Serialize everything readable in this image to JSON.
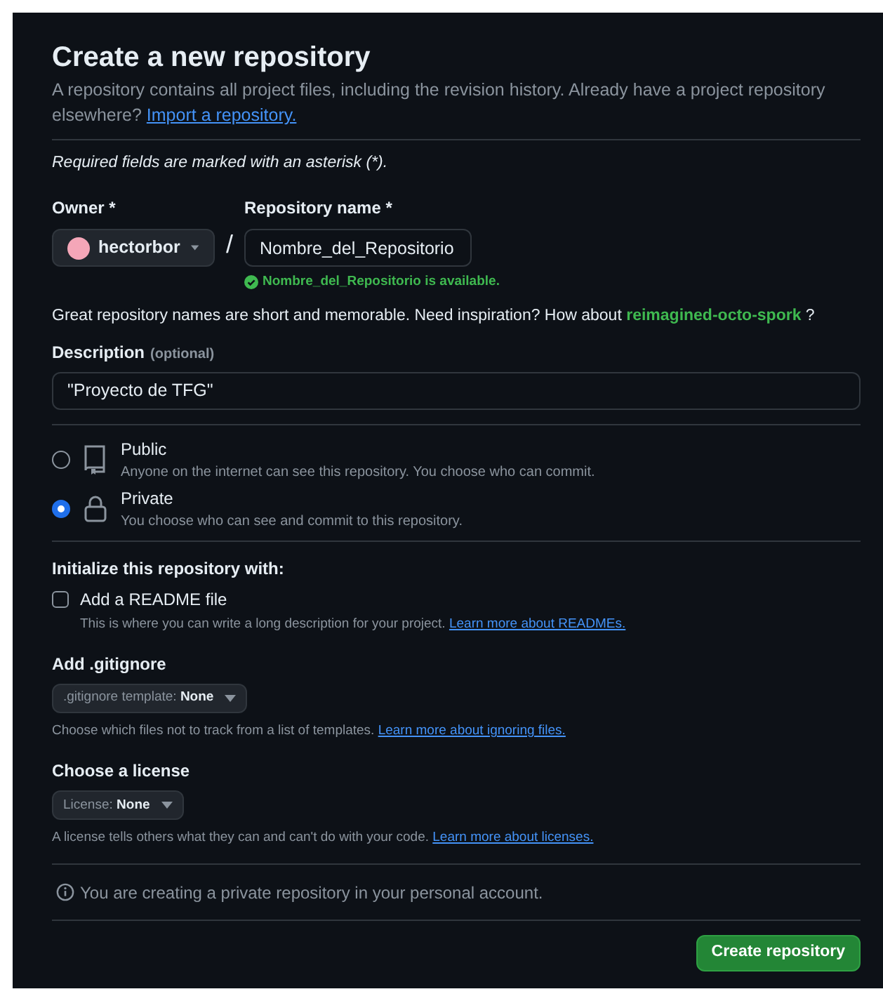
{
  "title": "Create a new repository",
  "intro": {
    "text": "A repository contains all project files, including the revision history. Already have a project repository elsewhere?",
    "link": "Import a repository."
  },
  "required_note": "Required fields are marked with an asterisk (*).",
  "owner": {
    "label": "Owner *",
    "value": "hectorbor"
  },
  "separator": "/",
  "repo_name": {
    "label": "Repository name *",
    "value": "Nombre_del_Repositorio",
    "status": "Nombre_del_Repositorio is available.",
    "available": true
  },
  "suggestion": {
    "text": "Great repository names are short and memorable. Need inspiration? How about",
    "name": "reimagined-octo-spork",
    "end": "?"
  },
  "description": {
    "label": "Description",
    "hint": "(optional)",
    "value": "\"Proyecto de TFG\""
  },
  "visibility": [
    {
      "kind": "public",
      "label": "Public",
      "desc": "Anyone on the internet can see this repository. You choose who can commit.",
      "selected": false
    },
    {
      "kind": "private",
      "label": "Private",
      "desc": "You choose who can see and commit to this repository.",
      "selected": true
    }
  ],
  "init": {
    "heading": "Initialize this repository with:",
    "readme": {
      "label": "Add a README file",
      "checked": false,
      "desc": "This is where you can write a long description for your project.",
      "link": "Learn more about READMEs."
    }
  },
  "gitignore": {
    "heading": "Add .gitignore",
    "prefix": ".gitignore template:",
    "value": "None",
    "desc": "Choose which files not to track from a list of templates.",
    "link": "Learn more about ignoring files."
  },
  "license": {
    "heading": "Choose a license",
    "prefix": "License:",
    "value": "None",
    "desc": "A license tells others what they can and can't do with your code.",
    "link": "Learn more about licenses."
  },
  "notice": "You are creating a private repository in your personal account.",
  "submit": "Create repository"
}
